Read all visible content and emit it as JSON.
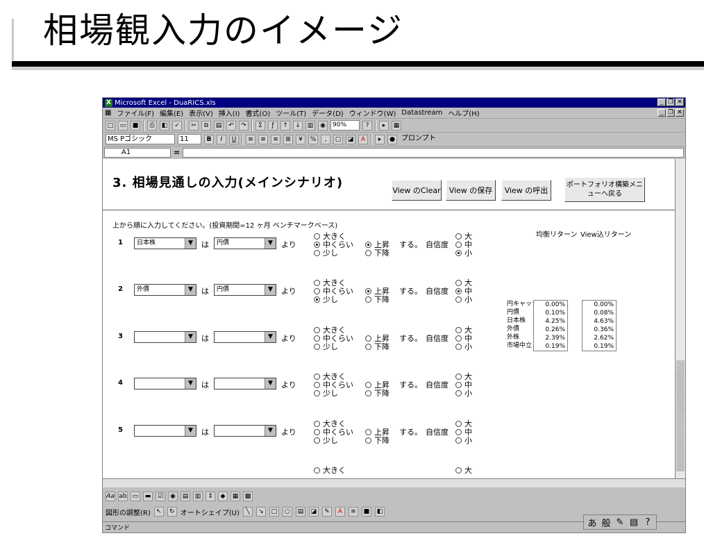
{
  "slide": {
    "title": "相場観入力のイメージ"
  },
  "window": {
    "title": "Microsoft Excel - DuaRICS.xls"
  },
  "menu": [
    "ファイル(F)",
    "編集(E)",
    "表示(V)",
    "挿入(I)",
    "書式(O)",
    "ツール(T)",
    "データ(D)",
    "ウィンドウ(W)",
    "Datastream",
    "ヘルプ(H)"
  ],
  "toolbar": {
    "zoom": "90%",
    "font": "MS Pゴシック",
    "size": "11",
    "prompt": "プロンプト"
  },
  "namebox": "A1",
  "sheet": {
    "heading": "3. 相場見通しの入力(メインシナリオ)",
    "buttons": [
      "View のClear",
      "View の保存",
      "View の呼出",
      "ポートフォリオ構築メニューへ戻る"
    ],
    "instruction": "上から順に入力してください。(投資期間=12 ヶ月 ベンチマークベース)",
    "labels": {
      "ha": "は",
      "yori": "より",
      "suru": "する。",
      "confidence": "自信度"
    },
    "magnitude": [
      "大きく",
      "中くらい",
      "少し"
    ],
    "direction": [
      "上昇",
      "下降"
    ],
    "confidence_levels": [
      "大",
      "中",
      "小"
    ],
    "rows": [
      {
        "num": "1",
        "asset1": "日本株",
        "asset2": "円債"
      },
      {
        "num": "2",
        "asset1": "外債",
        "asset2": "円債"
      },
      {
        "num": "3",
        "asset1": "",
        "asset2": ""
      },
      {
        "num": "4",
        "asset1": "",
        "asset2": ""
      },
      {
        "num": "5",
        "asset1": "",
        "asset2": ""
      }
    ],
    "returns": {
      "col1": "均衡リターン",
      "col2": "View込リターン",
      "assets": [
        "円キャッシュ",
        "円債",
        "日本株",
        "外債",
        "外株",
        "市場中立"
      ],
      "equilibrium": [
        "0.00%",
        "0.10%",
        "4.25%",
        "0.26%",
        "2.39%",
        "0.19%"
      ],
      "view": [
        "0.00%",
        "0.08%",
        "4.63%",
        "0.36%",
        "2.62%",
        "0.19%"
      ]
    }
  },
  "drawbar": {
    "adjust": "図形の調整(R)",
    "autoshape": "オートシェイプ(U)"
  },
  "status": "コマンド",
  "ime": [
    "あ",
    "般"
  ]
}
